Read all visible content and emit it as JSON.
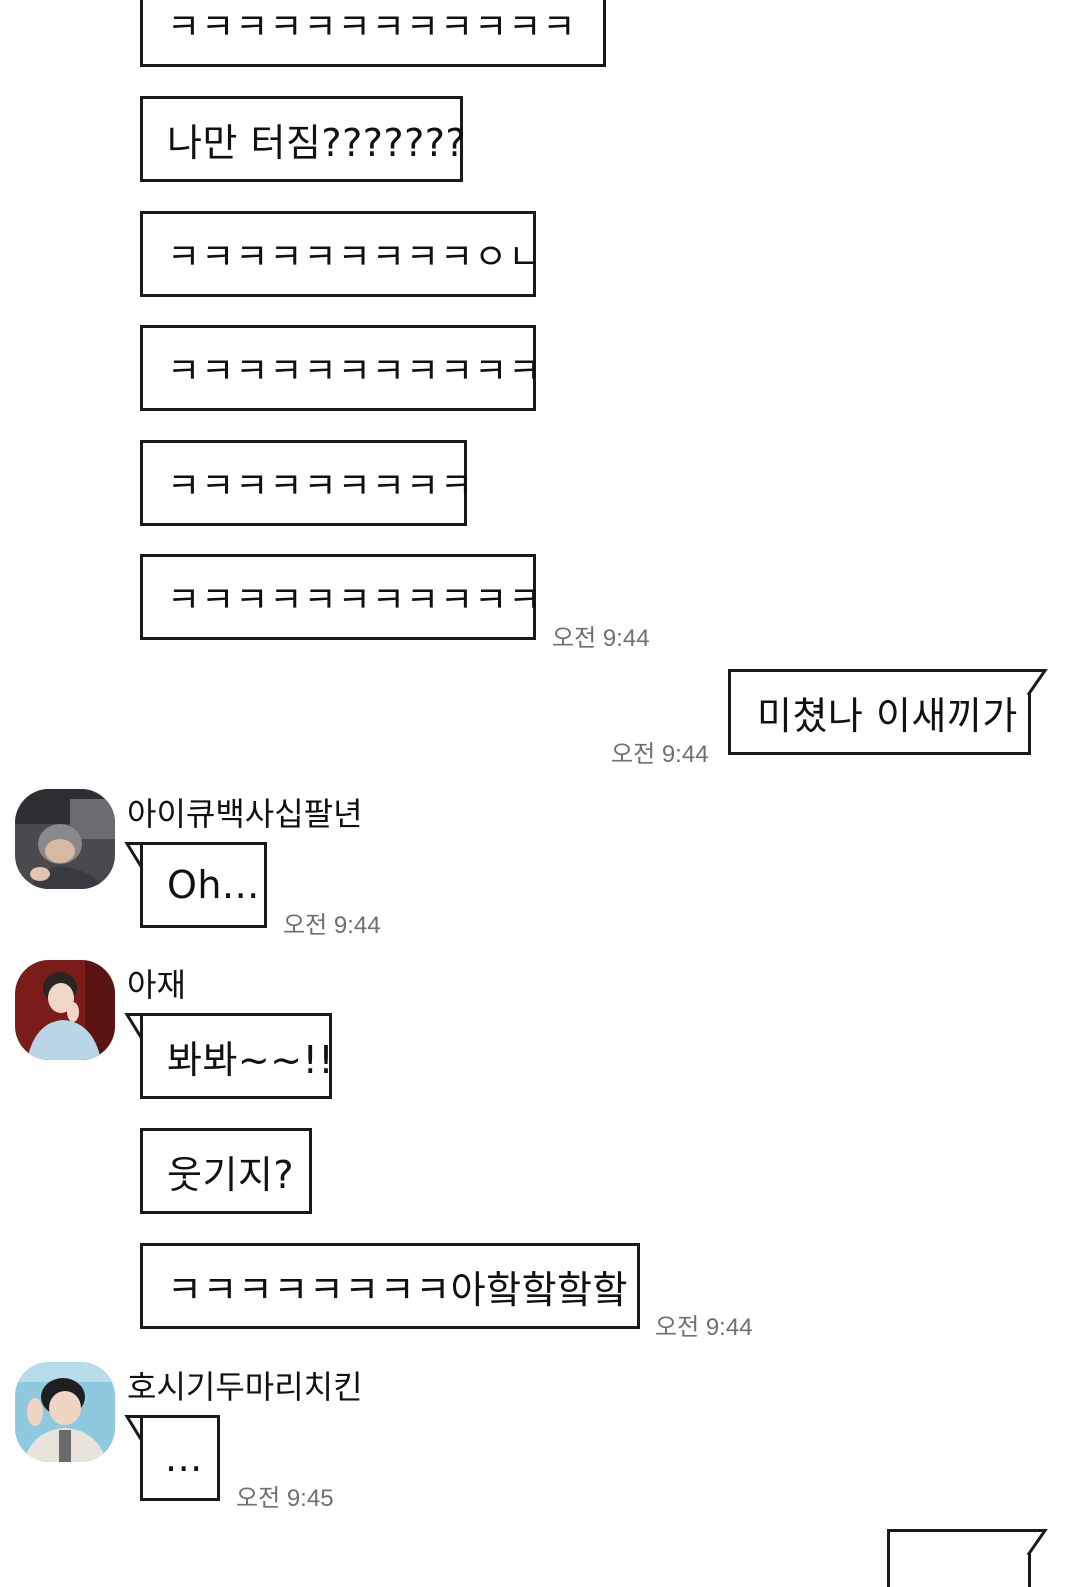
{
  "messages": {
    "m1": "ㅋㅋㅋㅋㅋㅋㅋㅋㅋㅋㅋㅋ",
    "m2": "나만 터짐???????",
    "m3": "ㅋㅋㅋㅋㅋㅋㅋㅋㅋㅇㄴ",
    "m4": "ㅋㅋㅋㅋㅋㅋㅋㅋㅋㅋㅋ",
    "m5": "ㅋㅋㅋㅋㅋㅋㅋㅋㅋ",
    "m6": "ㅋㅋㅋㅋㅋㅋㅋㅋㅋㅋㅋ",
    "m6_time": "오전 9:44",
    "me1": "미쳤나 이새끼가",
    "me1_time": "오전 9:44",
    "user1_name": "아이큐백사십팔년",
    "u1m1": "Oh...",
    "u1m1_time": "오전 9:44",
    "user2_name": "아재",
    "u2m1": "봐봐~~!!",
    "u2m2": "웃기지?",
    "u2m3": "ㅋㅋㅋㅋㅋㅋㅋㅋ아핰핰핰핰",
    "u2m3_time": "오전 9:44",
    "user3_name": "호시기두마리치킨",
    "u3m1": "...",
    "u3m1_time": "오전 9:45"
  },
  "colors": {
    "bubble_border": "#1a1a1a",
    "bubble_bg": "#ffffff",
    "timestamp": "#6f6f6f",
    "background": "#ffffff"
  },
  "icons": {
    "avatar1": "profile-photo",
    "avatar2": "profile-photo",
    "avatar3": "profile-photo"
  }
}
